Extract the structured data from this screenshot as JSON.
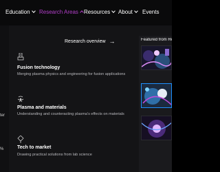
{
  "nav": {
    "items": [
      {
        "label": "Education",
        "state": "collapsed"
      },
      {
        "label": "Research Areas",
        "state": "expanded"
      },
      {
        "label": "Resources",
        "state": "collapsed"
      },
      {
        "label": "About",
        "state": "collapsed"
      },
      {
        "label": "Events"
      }
    ]
  },
  "panel": {
    "overview_link": "Research overview",
    "left_strip": [
      "ter",
      "%"
    ],
    "items": [
      {
        "title": "Fusion technology",
        "description": "Merging plasma physics and engineering for fusion applications",
        "icon": "fusion-icon"
      },
      {
        "title": "Plasma and materials",
        "description": "Understanding and counteracting plasma's effects on materials",
        "icon": "plasma-icon"
      },
      {
        "title": "Tech to market",
        "description": "Drawing practical solutions from lab science",
        "icon": "tech-icon"
      }
    ]
  },
  "featured": {
    "title": "Featured from Re"
  },
  "colors": {
    "accent": "#b23fc9",
    "background": "#000000",
    "panel": "#141416",
    "highlight_border": "#1e90ff"
  }
}
